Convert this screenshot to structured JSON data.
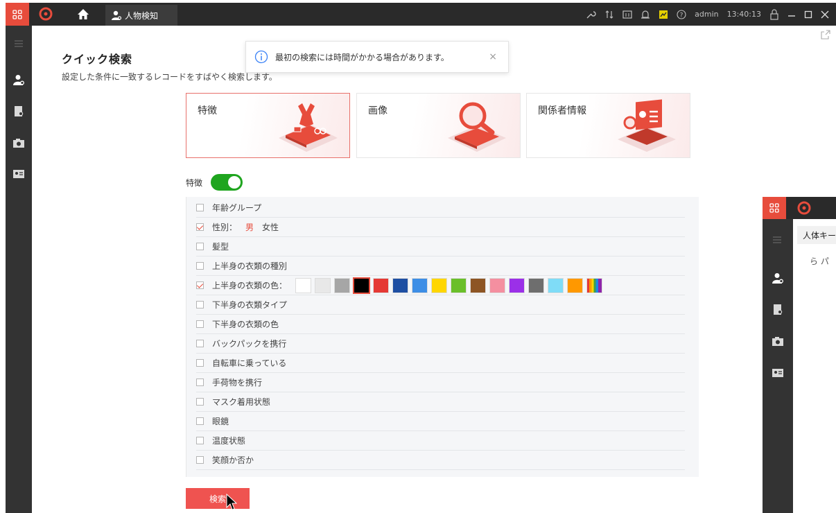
{
  "titlebar": {
    "tab_label": "人物検知",
    "user": "admin",
    "time": "13:40:13"
  },
  "toast": {
    "message": "最初の検索には時間がかかる場合があります。",
    "close": "×"
  },
  "page": {
    "title": "クイック検索",
    "description": "設定した条件に一致するレコードをすばやく検索します。"
  },
  "cards": [
    {
      "label": "特徴",
      "icon": "feature-icon",
      "active": true
    },
    {
      "label": "画像",
      "icon": "magnifier-icon",
      "active": false
    },
    {
      "label": "関係者情報",
      "icon": "id-card-icon",
      "active": false
    }
  ],
  "feature_toggle": {
    "label": "特徴",
    "on": true
  },
  "criteria": [
    {
      "label": "年齢グループ",
      "checked": false
    },
    {
      "label": "性別：",
      "checked": true,
      "options": [
        "男",
        "女性"
      ],
      "selected": "男"
    },
    {
      "label": "髪型",
      "checked": false
    },
    {
      "label": "上半身の衣類の種別",
      "checked": false
    },
    {
      "label": "上半身の衣類の色：",
      "checked": true
    },
    {
      "label": "下半身の衣類タイプ",
      "checked": false
    },
    {
      "label": "下半身の衣類の色",
      "checked": false
    },
    {
      "label": "バックパックを携行",
      "checked": false
    },
    {
      "label": "自転車に乗っている",
      "checked": false
    },
    {
      "label": "手荷物を携行",
      "checked": false
    },
    {
      "label": "マスク着用状態",
      "checked": false
    },
    {
      "label": "眼鏡",
      "checked": false
    },
    {
      "label": "温度状態",
      "checked": false
    },
    {
      "label": "笑顔か否か",
      "checked": false
    }
  ],
  "colors": [
    "#ffffff",
    "#e8e8e8",
    "#a6a6a6",
    "#000000",
    "#e53935",
    "#1e4fa3",
    "#3d8ee6",
    "#ffd600",
    "#6abf2a",
    "#8d5524",
    "#f48fa0",
    "#9b30e8",
    "#6e6e6e",
    "#7fdcf7",
    "#ff9800",
    "rainbow"
  ],
  "selected_color_index": 3,
  "search_button": "検索",
  "second_window": {
    "tab_label": "人体キー",
    "text": "ら パ"
  }
}
